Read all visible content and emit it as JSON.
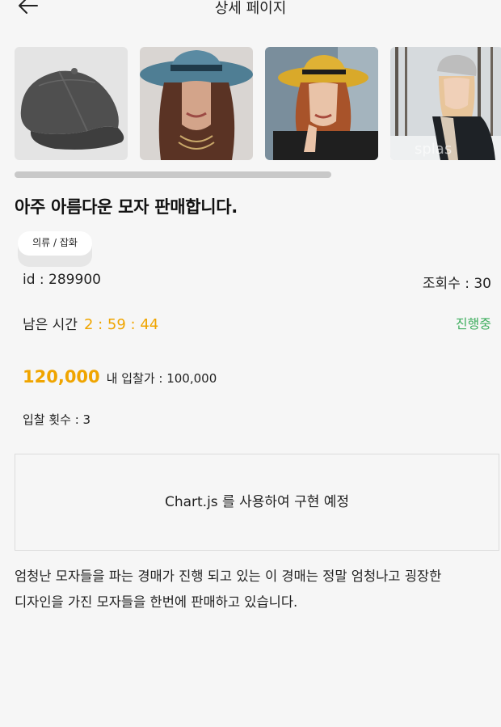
{
  "header": {
    "title": "상세 페이지",
    "back_icon": "arrow-left-icon"
  },
  "gallery": {
    "images": [
      {
        "alt": "grey-baseball-cap"
      },
      {
        "alt": "woman-blue-fedora"
      },
      {
        "alt": "woman-yellow-hat"
      },
      {
        "alt": "woman-knit-beanie-snow"
      }
    ],
    "watermark": "splas"
  },
  "item": {
    "title": "아주 아름다운 모자 판매합니다.",
    "category": "의류 / 잡화",
    "id_text": "id : 289900",
    "views_text": "조회수 : 30",
    "remaining_label": "남은 시간",
    "remaining_value": "2 : 59 : 44",
    "status": "진행중",
    "price": "120,000",
    "my_bid": "내 입찰가 : 100,000",
    "bid_count": "입찰 횟수 : 3",
    "chart_placeholder": "Chart.js 를 사용하여 구현 예정",
    "description_line1": "엄청난 모자들을 파는 경매가 진행 되고 있는 이 경매는 정말 엄청나고 굉장한",
    "description_line2": "디자인을 가진 모자들을 한번에 판매하고 있습니다."
  },
  "colors": {
    "accent": "#f0a500",
    "status_green": "#3fae5f",
    "background": "#f6f6f6"
  }
}
